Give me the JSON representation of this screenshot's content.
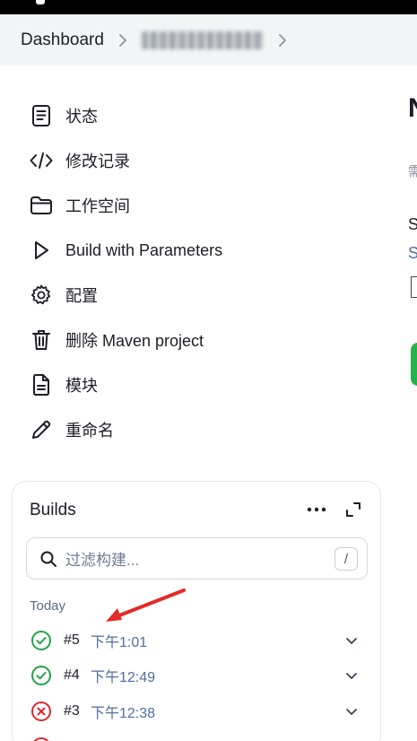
{
  "breadcrumb": {
    "root": "Dashboard",
    "job": ""
  },
  "sidebar": {
    "items": [
      {
        "label": "状态",
        "icon": "document-icon"
      },
      {
        "label": "修改记录",
        "icon": "code-icon"
      },
      {
        "label": "工作空间",
        "icon": "folder-icon"
      },
      {
        "label": "Build with Parameters",
        "icon": "play-icon"
      },
      {
        "label": "配置",
        "icon": "gear-icon"
      },
      {
        "label": "删除 Maven project",
        "icon": "trash-icon"
      },
      {
        "label": "模块",
        "icon": "file-icon"
      },
      {
        "label": "重命名",
        "icon": "pencil-icon"
      }
    ]
  },
  "right_panel": {
    "heading_fragment": "N",
    "desc_fragment": "需",
    "label_fragment": "S",
    "link_fragment": "S"
  },
  "builds": {
    "title": "Builds",
    "filter_placeholder": "过滤构建...",
    "filter_shortcut": "/",
    "group_label": "Today",
    "items": [
      {
        "number": "#5",
        "time": "下午1:01",
        "status": "success"
      },
      {
        "number": "#4",
        "time": "下午12:49",
        "status": "success"
      },
      {
        "number": "#3",
        "time": "下午12:38",
        "status": "failure"
      }
    ]
  },
  "colors": {
    "success": "#1fa34a",
    "failure": "#e0242f",
    "link": "#4e6f9e",
    "annotation_arrow": "#e52a2a",
    "run_button": "#26b24a"
  }
}
